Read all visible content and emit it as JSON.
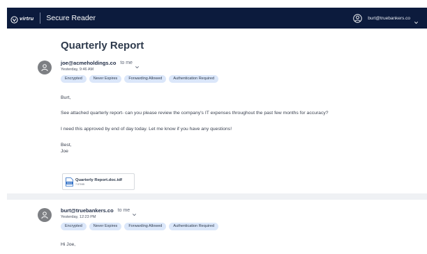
{
  "app": {
    "logo_text": "virtru",
    "title": "Secure Reader",
    "user_email": "burt@truebankers.co"
  },
  "subject": "Quarterly Report",
  "messages": [
    {
      "sender": "joe@acmeholdings.co",
      "to": "to me",
      "time": "Yesterday, 9:46 AM",
      "tags": [
        "Encrypted",
        "Never Expires",
        "Forwarding Allowed",
        "Authentication Required"
      ],
      "body": [
        "Burt,",
        "See attached quarterly report- can you please review the company's IT expenses throughout the past few months for accuracy?",
        "I need this approved by end of day today. Let me know if you have any questions!",
        "Best,",
        "Joe"
      ],
      "attachment": {
        "name": "Quarterly Report.doc.tdf",
        "size": "7.57MB",
        "type_label": "DOCX"
      }
    },
    {
      "sender": "burt@truebankers.co",
      "to": "to me",
      "time": "Yesterday, 12:23 PM",
      "tags": [
        "Encrypted",
        "Never Expires",
        "Forwarding Allowed",
        "Authentication Required"
      ],
      "body": [
        "Hi Joe,"
      ]
    }
  ],
  "colors": {
    "topbar": "#0c1b3d",
    "tag_bg": "#dbe7fa",
    "avatar": "#7d7f83"
  },
  "icons": {
    "logo": "virtru-logo-icon",
    "user": "user-circle-icon",
    "caret": "chevron-down-icon",
    "avatar": "person-icon",
    "file": "docx-file-icon"
  }
}
